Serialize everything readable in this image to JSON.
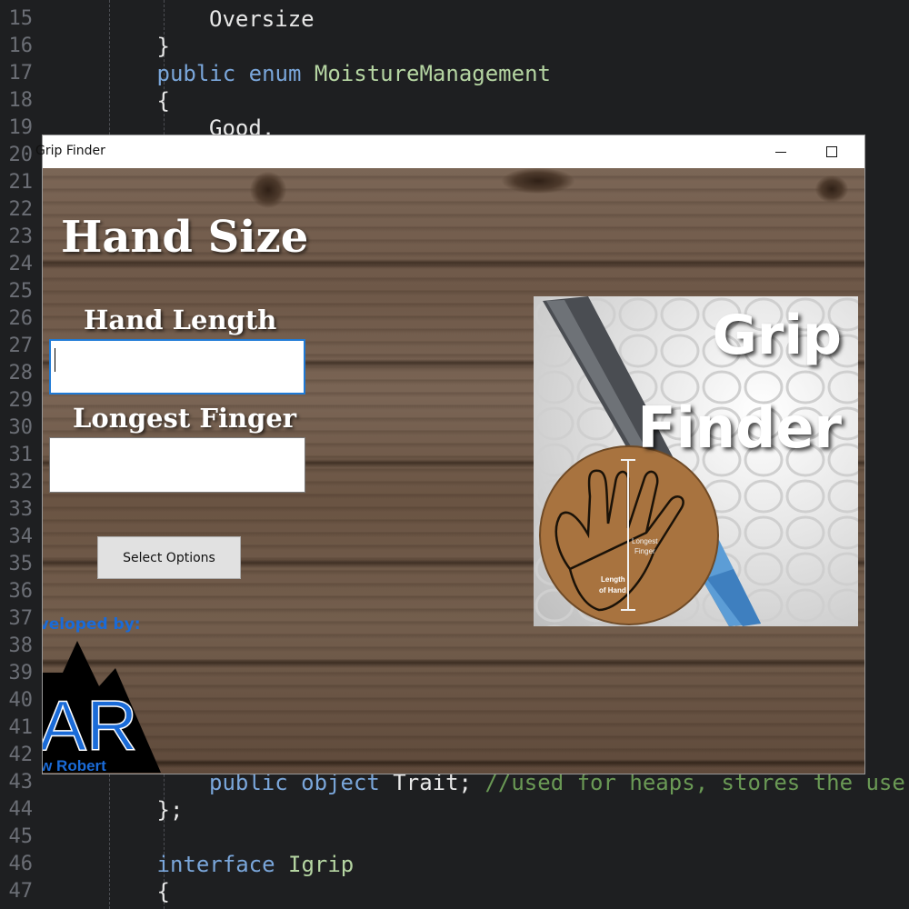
{
  "editor": {
    "lines": [
      {
        "num": "15",
        "code": "Oversize",
        "indent": 2
      },
      {
        "num": "16",
        "code": "}",
        "indent": 1
      },
      {
        "num": "17",
        "kw": "public enum ",
        "type": "MoistureManagement",
        "indent": 1
      },
      {
        "num": "18",
        "code": "{",
        "indent": 1
      },
      {
        "num": "19",
        "code": "Good,",
        "indent": 2
      },
      {
        "num": "20"
      },
      {
        "num": "21"
      },
      {
        "num": "22"
      },
      {
        "num": "23"
      },
      {
        "num": "24"
      },
      {
        "num": "25"
      },
      {
        "num": "26"
      },
      {
        "num": "27"
      },
      {
        "num": "28"
      },
      {
        "num": "29"
      },
      {
        "num": "30"
      },
      {
        "num": "31"
      },
      {
        "num": "32"
      },
      {
        "num": "33"
      },
      {
        "num": "34"
      },
      {
        "num": "35"
      },
      {
        "num": "36"
      },
      {
        "num": "37"
      },
      {
        "num": "38"
      },
      {
        "num": "39"
      },
      {
        "num": "40"
      },
      {
        "num": "41"
      },
      {
        "num": "42"
      },
      {
        "num": "43",
        "kw": "public object ",
        "code": "Trait; ",
        "comment": "//used for heaps, stores the user",
        "indent": 2
      },
      {
        "num": "44",
        "code": "};",
        "indent": 1
      },
      {
        "num": "45"
      },
      {
        "num": "46",
        "kw": "interface ",
        "type": "Igrip",
        "indent": 1
      },
      {
        "num": "47",
        "code": "{",
        "indent": 1
      }
    ]
  },
  "window": {
    "title": "Grip Finder",
    "minimize_glyph": "minimize",
    "maximize_glyph": "maximize"
  },
  "form": {
    "heading": "Hand Size",
    "hand_length_label": "Hand Length",
    "hand_length_value": "",
    "longest_finger_label": "Longest Finger",
    "longest_finger_value": "",
    "select_button_label": "Select Options",
    "developed_by": "Developed by:",
    "logo_initials": "AR",
    "logo_name": "Andrew Robert"
  },
  "grip_image": {
    "title_line1": "Grip",
    "title_line2": "Finder",
    "finger_label_1": "Longest",
    "finger_label_2": "Finger",
    "length_label_1": "Length",
    "length_label_2": "of Hand"
  },
  "colors": {
    "editor_bg": "#1e1f21",
    "keyword": "#7aa6da",
    "type": "#b5d5a2",
    "comment": "#6a9955",
    "logo_blue": "#1a6bd8",
    "hand_circle": "#a8733f"
  }
}
